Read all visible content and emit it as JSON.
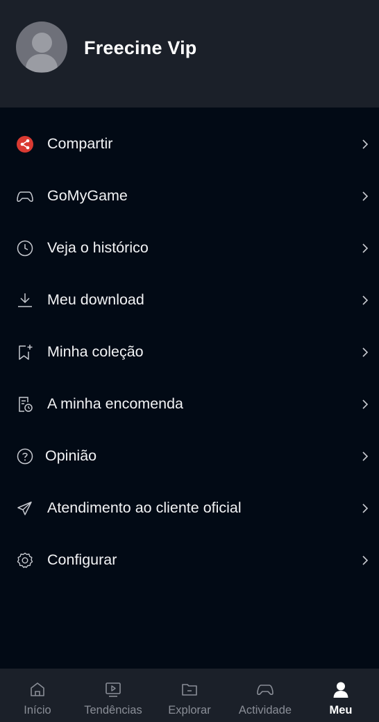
{
  "profile": {
    "name": "Freecine Vip"
  },
  "menu": {
    "items": [
      {
        "label": "Compartir",
        "icon": "share-icon"
      },
      {
        "label": "GoMyGame",
        "icon": "gamepad-icon"
      },
      {
        "label": "Veja o histórico",
        "icon": "clock-icon"
      },
      {
        "label": "Meu download",
        "icon": "download-icon"
      },
      {
        "label": "Minha coleção",
        "icon": "bookmark-add-icon"
      },
      {
        "label": "A minha encomenda",
        "icon": "order-icon"
      },
      {
        "label": "Opinião",
        "icon": "help-circle-icon"
      },
      {
        "label": "Atendimento ao cliente oficial",
        "icon": "paper-plane-icon"
      },
      {
        "label": "Configurar",
        "icon": "gear-icon"
      }
    ]
  },
  "tabbar": {
    "tabs": [
      {
        "label": "Início",
        "icon": "home-icon",
        "active": false
      },
      {
        "label": "Tendências",
        "icon": "play-screen-icon",
        "active": false
      },
      {
        "label": "Explorar",
        "icon": "folder-icon",
        "active": false
      },
      {
        "label": "Actividade",
        "icon": "gamepad-icon",
        "active": false
      },
      {
        "label": "Meu",
        "icon": "person-icon",
        "active": true
      }
    ]
  },
  "colors": {
    "background": "#020a15",
    "header_bg": "#1b2029",
    "share_accent": "#d93a32",
    "inactive_tab": "#8a8e97"
  }
}
